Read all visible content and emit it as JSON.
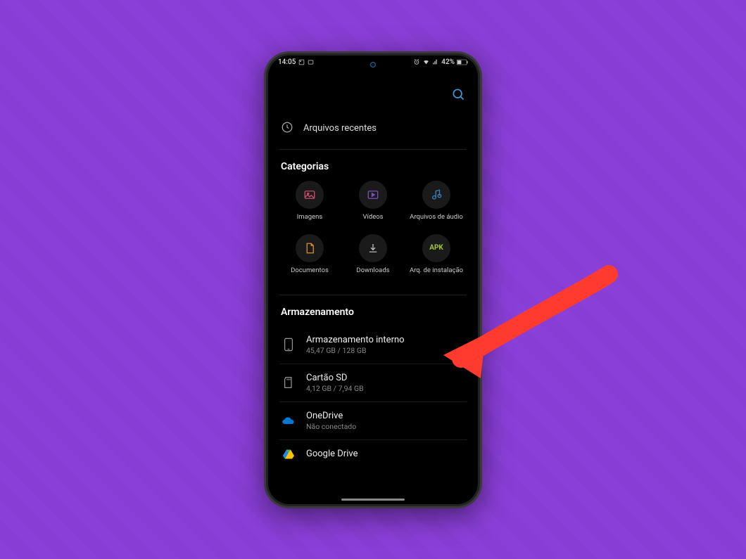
{
  "status": {
    "time": "14:05",
    "battery": "42%"
  },
  "appbar": {
    "search": "Search"
  },
  "recent": {
    "label": "Arquivos recentes"
  },
  "categories": {
    "title": "Categorias",
    "items": [
      {
        "label": "Imagens",
        "icon": "image"
      },
      {
        "label": "Vídeos",
        "icon": "video"
      },
      {
        "label": "Arquivos de áudio",
        "icon": "audio"
      },
      {
        "label": "Documentos",
        "icon": "document"
      },
      {
        "label": "Downloads",
        "icon": "download"
      },
      {
        "label": "Arq. de instalação",
        "icon": "apk"
      }
    ]
  },
  "storage": {
    "title": "Armazenamento",
    "items": [
      {
        "title": "Armazenamento interno",
        "sub": "45,47 GB / 128 GB",
        "icon": "phone"
      },
      {
        "title": "Cartão SD",
        "sub": "4,12 GB / 7,94 GB",
        "icon": "sd"
      },
      {
        "title": "OneDrive",
        "sub": "Não conectado",
        "icon": "onedrive"
      },
      {
        "title": "Google Drive",
        "sub": "",
        "icon": "gdrive"
      }
    ]
  }
}
